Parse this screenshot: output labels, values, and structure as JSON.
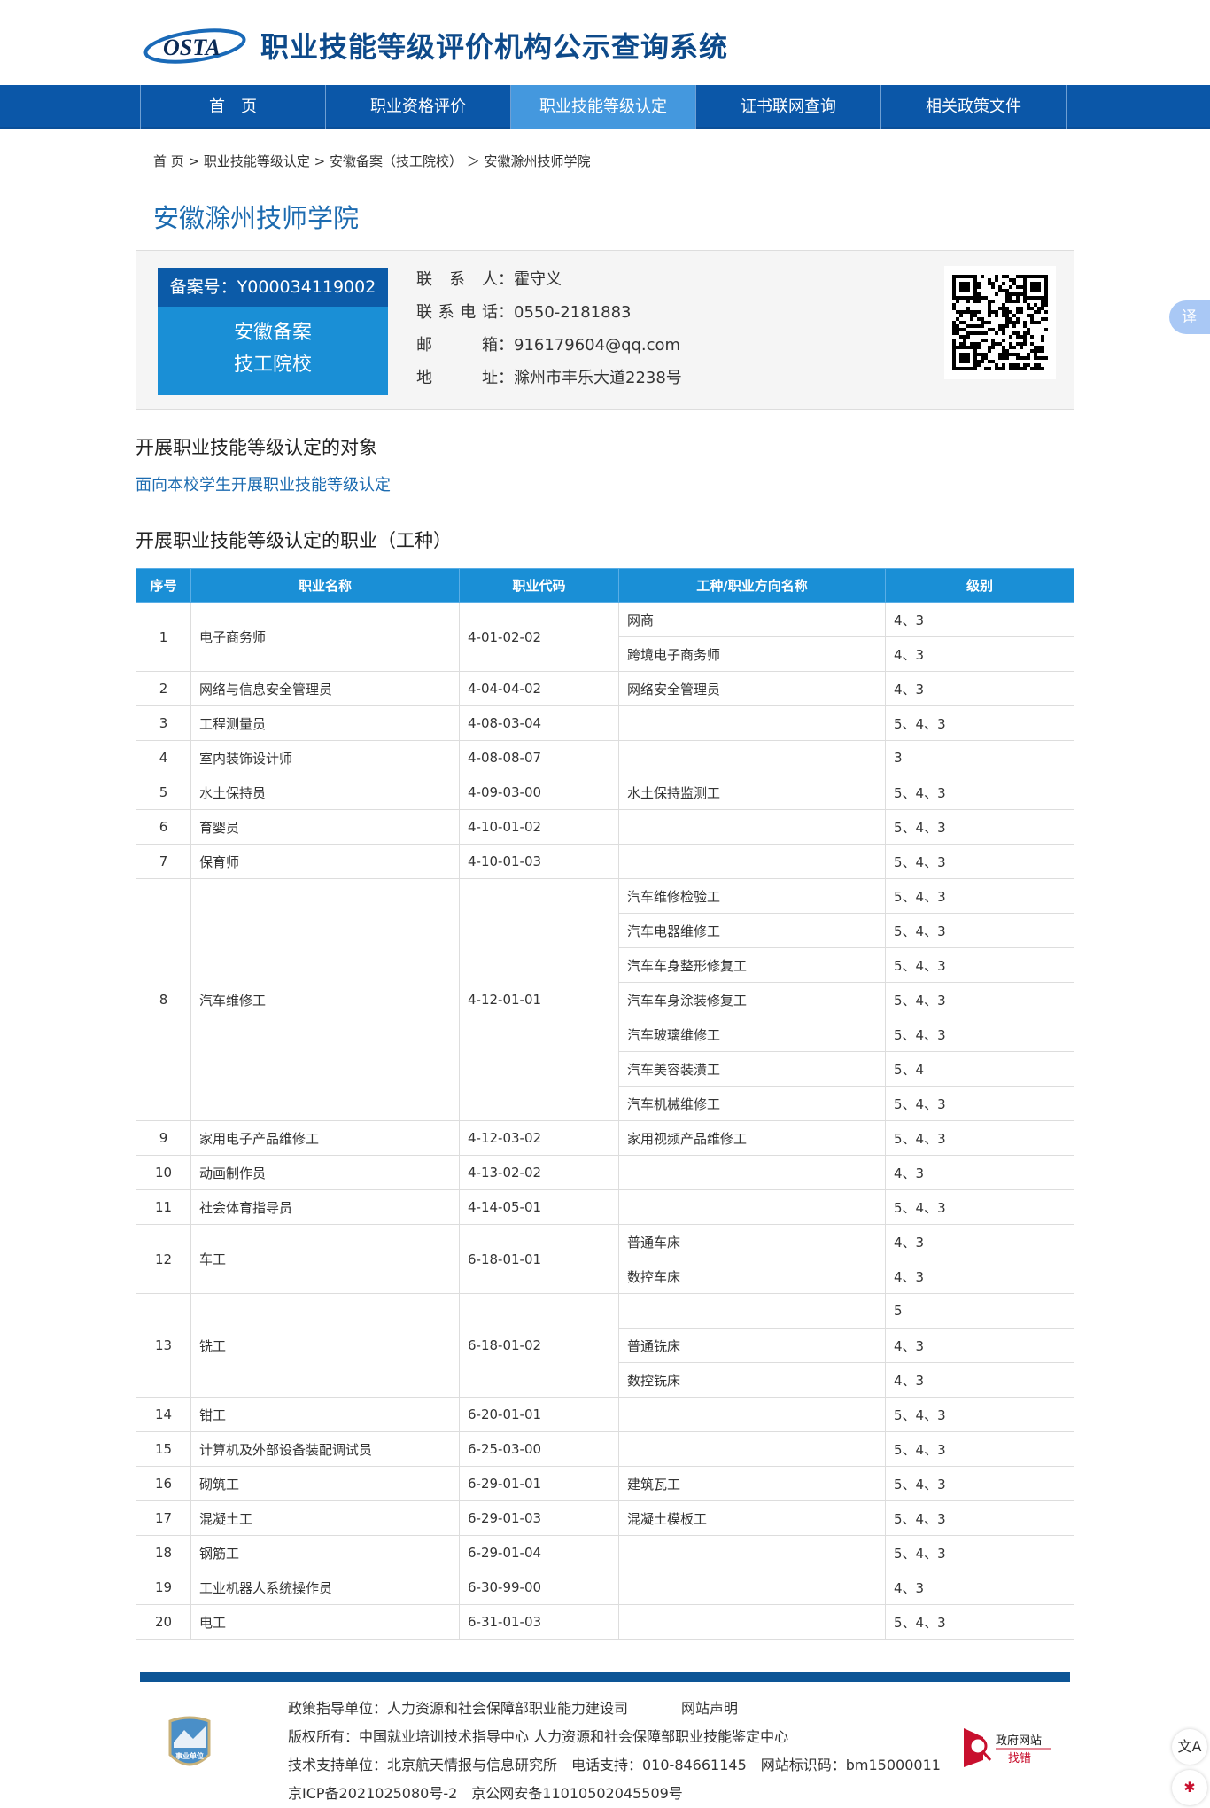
{
  "header": {
    "logo_text": "OSTA",
    "title": "职业技能等级评价机构公示查询系统"
  },
  "nav": [
    "首　页",
    "职业资格评价",
    "职业技能等级认定",
    "证书联网查询",
    "相关政策文件"
  ],
  "breadcrumb": [
    "首 页",
    " > 职业技能等级认定",
    " > 安徽备案（技工院校）",
    " ＞ 安徽滁州技师学院"
  ],
  "org": {
    "name": "安徽滁州技师学院",
    "record_label": "备案号：Y000034119002",
    "type_line1": "安徽备案",
    "type_line2": "技工院校",
    "contacts": [
      {
        "label": "联系人",
        "value": "：霍守义"
      },
      {
        "label": "联系电话",
        "value": "：0550-2181883"
      },
      {
        "label": "邮箱",
        "value": "：916179604@qq.com"
      },
      {
        "label": "地址",
        "value": "：滁州市丰乐大道2238号"
      }
    ]
  },
  "section_target": {
    "title": "开展职业技能等级认定的对象",
    "text": "面向本校学生开展职业技能等级认定"
  },
  "section_jobs": {
    "title": "开展职业技能等级认定的职业（工种）"
  },
  "table": {
    "headers": [
      "序号",
      "职业名称",
      "职业代码",
      "工种/职业方向名称",
      "级别"
    ],
    "rows": [
      {
        "no": "1",
        "name": "电子商务师",
        "code": "4-01-02-02",
        "subs": [
          [
            "网商",
            "4、3"
          ],
          [
            "跨境电子商务师",
            "4、3"
          ]
        ]
      },
      {
        "no": "2",
        "name": "网络与信息安全管理员",
        "code": "4-04-04-02",
        "subs": [
          [
            "网络安全管理员",
            "4、3"
          ]
        ]
      },
      {
        "no": "3",
        "name": "工程测量员",
        "code": "4-08-03-04",
        "subs": [
          [
            "",
            "5、4、3"
          ]
        ]
      },
      {
        "no": "4",
        "name": "室内装饰设计师",
        "code": "4-08-08-07",
        "subs": [
          [
            "",
            "3"
          ]
        ]
      },
      {
        "no": "5",
        "name": "水土保持员",
        "code": "4-09-03-00",
        "subs": [
          [
            "水土保持监测工",
            "5、4、3"
          ]
        ]
      },
      {
        "no": "6",
        "name": "育婴员",
        "code": "4-10-01-02",
        "subs": [
          [
            "",
            "5、4、3"
          ]
        ]
      },
      {
        "no": "7",
        "name": "保育师",
        "code": "4-10-01-03",
        "subs": [
          [
            "",
            "5、4、3"
          ]
        ]
      },
      {
        "no": "8",
        "name": "汽车维修工",
        "code": "4-12-01-01",
        "subs": [
          [
            "汽车维修检验工",
            "5、4、3"
          ],
          [
            "汽车电器维修工",
            "5、4、3"
          ],
          [
            "汽车车身整形修复工",
            "5、4、3"
          ],
          [
            "汽车车身涂装修复工",
            "5、4、3"
          ],
          [
            "汽车玻璃维修工",
            "5、4、3"
          ],
          [
            "汽车美容装潢工",
            "5、4"
          ],
          [
            "汽车机械维修工",
            "5、4、3"
          ]
        ]
      },
      {
        "no": "9",
        "name": "家用电子产品维修工",
        "code": "4-12-03-02",
        "subs": [
          [
            "家用视频产品维修工",
            "5、4、3"
          ]
        ]
      },
      {
        "no": "10",
        "name": "动画制作员",
        "code": "4-13-02-02",
        "subs": [
          [
            "",
            "4、3"
          ]
        ]
      },
      {
        "no": "11",
        "name": "社会体育指导员",
        "code": "4-14-05-01",
        "subs": [
          [
            "",
            "5、4、3"
          ]
        ]
      },
      {
        "no": "12",
        "name": "车工",
        "code": "6-18-01-01",
        "subs": [
          [
            "普通车床",
            "4、3"
          ],
          [
            "数控车床",
            "4、3"
          ]
        ]
      },
      {
        "no": "13",
        "name": "铣工",
        "code": "6-18-01-02",
        "subs": [
          [
            "",
            "5"
          ],
          [
            "普通铣床",
            "4、3"
          ],
          [
            "数控铣床",
            "4、3"
          ]
        ]
      },
      {
        "no": "14",
        "name": "钳工",
        "code": "6-20-01-01",
        "subs": [
          [
            "",
            "5、4、3"
          ]
        ]
      },
      {
        "no": "15",
        "name": "计算机及外部设备装配调试员",
        "code": "6-25-03-00",
        "subs": [
          [
            "",
            "5、4、3"
          ]
        ]
      },
      {
        "no": "16",
        "name": "砌筑工",
        "code": "6-29-01-01",
        "subs": [
          [
            "建筑瓦工",
            "5、4、3"
          ]
        ]
      },
      {
        "no": "17",
        "name": "混凝土工",
        "code": "6-29-01-03",
        "subs": [
          [
            "混凝土模板工",
            "5、4、3"
          ]
        ]
      },
      {
        "no": "18",
        "name": "钢筋工",
        "code": "6-29-01-04",
        "subs": [
          [
            "",
            "5、4、3"
          ]
        ]
      },
      {
        "no": "19",
        "name": "工业机器人系统操作员",
        "code": "6-30-99-00",
        "subs": [
          [
            "",
            "4、3"
          ]
        ]
      },
      {
        "no": "20",
        "name": "电工",
        "code": "6-31-01-03",
        "subs": [
          [
            "",
            "5、4、3"
          ]
        ]
      }
    ]
  },
  "footer": {
    "line1": "政策指导单位：人力资源和社会保障部职业能力建设司",
    "statement": "网站声明",
    "line2": "版权所有：中国就业培训技术指导中心 人力资源和社会保障部职业技能鉴定中心",
    "line3": "技术支持单位：北京航天情报与信息研究所　电话支持：010-84661145　网站标识码：bm15000011",
    "line4": "京ICP备2021025080号-2　京公网安备11010502045509号",
    "emblem_text": "事业单位",
    "gov_text1": "政府网站",
    "gov_text2": "找错"
  },
  "float": {
    "translate": "译"
  }
}
